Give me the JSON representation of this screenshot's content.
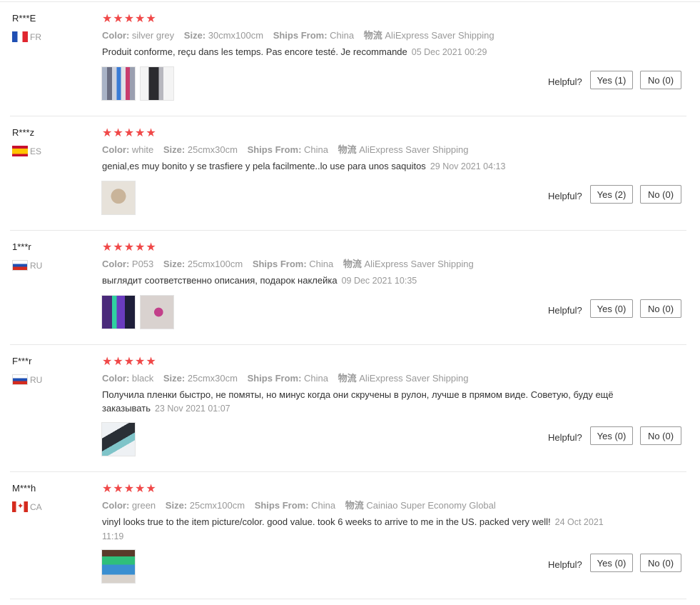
{
  "labels": {
    "color": "Color:",
    "size": "Size:",
    "ships_from": "Ships From:",
    "logistics": "物流",
    "helpful": "Helpful?"
  },
  "star_icons": "★★★★★",
  "reviews": [
    {
      "user": "R***E",
      "country": "FR",
      "flag": "flag-fr",
      "rating": 5,
      "color": "silver grey",
      "size": "30cmx100cm",
      "ships_from": "China",
      "shipping": "AliExpress Saver Shipping",
      "comment": "Produit conforme, reçu dans les temps. Pas encore testé. Je recommande",
      "date": "05 Dec 2021 00:29",
      "yes": "Yes (1)",
      "no": "No (0)",
      "photo_count": 2
    },
    {
      "user": "R***z",
      "country": "ES",
      "flag": "flag-es",
      "rating": 5,
      "color": "white",
      "size": "25cmx30cm",
      "ships_from": "China",
      "shipping": "AliExpress Saver Shipping",
      "comment": "genial,es muy bonito y se trasfiere y pela facilmente..lo use para unos saquitos",
      "date": "29 Nov 2021 04:13",
      "yes": "Yes (2)",
      "no": "No (0)",
      "photo_count": 1
    },
    {
      "user": "1***r",
      "country": "RU",
      "flag": "flag-ru",
      "rating": 5,
      "color": "P053",
      "size": "25cmx100cm",
      "ships_from": "China",
      "shipping": "AliExpress Saver Shipping",
      "comment": "выглядит соответственно описания, подарок наклейка",
      "date": "09 Dec 2021 10:35",
      "yes": "Yes (0)",
      "no": "No (0)",
      "photo_count": 2
    },
    {
      "user": "F***r",
      "country": "RU",
      "flag": "flag-ru",
      "rating": 5,
      "color": "black",
      "size": "25cmx30cm",
      "ships_from": "China",
      "shipping": "AliExpress Saver Shipping",
      "comment": "Получила пленки быстро, не помяты, но минус когда они скручены в рулон, лучше в прямом виде. Советую, буду ещё заказывать",
      "date": "23 Nov 2021 01:07",
      "yes": "Yes (0)",
      "no": "No (0)",
      "photo_count": 1
    },
    {
      "user": "M***h",
      "country": "CA",
      "flag": "flag-ca",
      "rating": 5,
      "color": "green",
      "size": "25cmx100cm",
      "ships_from": "China",
      "shipping": "Cainiao Super Economy Global",
      "comment": "vinyl looks true to the item picture/color. good value. took 6 weeks to arrive to me in the US. packed very well!",
      "date": "24 Oct 2021 11:19",
      "yes": "Yes (0)",
      "no": "No (0)",
      "photo_count": 1
    }
  ]
}
